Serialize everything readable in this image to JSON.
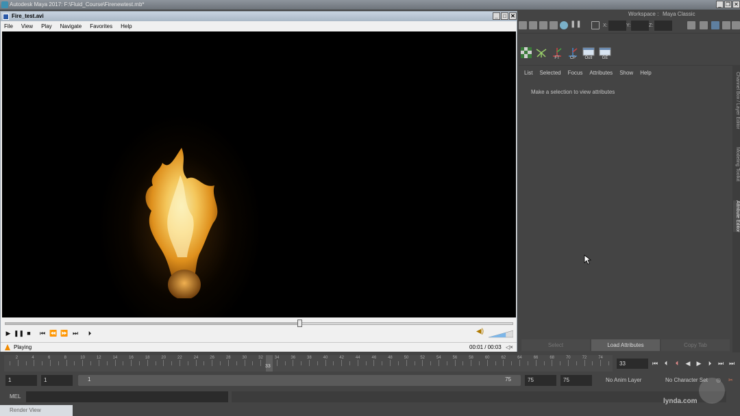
{
  "app": {
    "title": "Autodesk Maya 2017: F:\\Fluid_Course\\Firenewtest.mb*"
  },
  "player": {
    "title": "Fire_test.avi",
    "menu": [
      "File",
      "View",
      "Play",
      "Navigate",
      "Favorites",
      "Help"
    ],
    "progress_fraction": 0.58,
    "status_text": "Playing",
    "time_text": "00:01 / 00:03",
    "volume_fraction": 0.7
  },
  "workspace": {
    "label": "Workspace :",
    "value": "Maya Classic"
  },
  "status_line": {
    "x_label": "X:",
    "y_label": "Y:",
    "z_label": "Z:"
  },
  "shelf": {
    "items": [
      "FT",
      "CP",
      "Outl",
      "GE"
    ]
  },
  "attribute_editor": {
    "menu": [
      "List",
      "Selected",
      "Focus",
      "Attributes",
      "Show",
      "Help"
    ],
    "hint": "Make a selection to view attributes",
    "buttons": {
      "select": "Select",
      "load": "Load Attributes",
      "copy": "Copy Tab"
    }
  },
  "side_tabs": [
    "Channel Box / Layer Editor",
    "Modeling Toolkit",
    "Attribute Editor"
  ],
  "timeline": {
    "ticks": [
      2,
      4,
      6,
      8,
      10,
      12,
      14,
      16,
      18,
      20,
      22,
      24,
      26,
      28,
      30,
      32,
      34,
      36,
      38,
      40,
      42,
      44,
      46,
      48,
      50,
      52,
      54,
      56,
      58,
      60,
      62,
      64,
      66,
      68,
      70,
      72,
      74
    ],
    "current_frame": 33,
    "current_frame_text": "33",
    "start": 1,
    "end": 75
  },
  "range": {
    "start_field": "1",
    "start_inner": "1",
    "bar_start": "1",
    "bar_end": "75",
    "end_inner": "75",
    "end_field": "75",
    "anim_layer": "No Anim Layer",
    "character_set": "No Character Set"
  },
  "command_line": {
    "label": "MEL"
  },
  "taskbar": {
    "render_view": "Render View"
  },
  "watermark": "lynda.com"
}
